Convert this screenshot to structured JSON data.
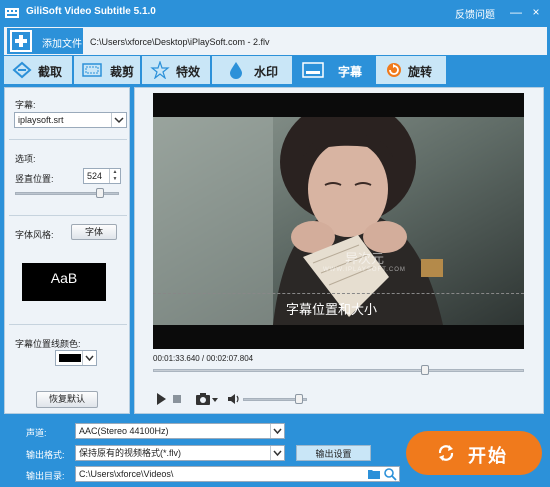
{
  "titlebar": {
    "title": "GiliSoft Video Subtitle 5.1.0",
    "feedback": "反馈问题",
    "minimize": "—",
    "close": "×"
  },
  "file": {
    "add_label": "添加文件",
    "path": "C:\\Users\\xforce\\Desktop\\iPlaySoft.com - 2.flv"
  },
  "tabs": [
    {
      "label": "截取",
      "icon": "crop-icon"
    },
    {
      "label": "裁剪",
      "icon": "trim-icon"
    },
    {
      "label": "特效",
      "icon": "effects-icon"
    },
    {
      "label": "水印",
      "icon": "watermark-icon"
    },
    {
      "label": "字幕",
      "icon": "subtitle-icon",
      "active": true
    },
    {
      "label": "旋转",
      "icon": "rotate-icon"
    }
  ],
  "left": {
    "subtitle_label": "字幕:",
    "subtitle_file": "iplaysoft.srt",
    "options_label": "选项:",
    "vpos_label": "竖直位置:",
    "vpos_value": "524",
    "vpos_slider": 0.82,
    "font_style_label": "字体风格:",
    "font_button": "字体",
    "font_preview": "AaB",
    "line_color_label": "字幕位置线颜色:",
    "line_color": "#000000",
    "reset_button": "恢复默认"
  },
  "preview": {
    "subtitle_text": "字幕位置和大小",
    "watermark_main": "异次元",
    "watermark_sub": "WWW.IPLAYSOFT.COM",
    "time": "00:01:33.640 / 00:02:07.804",
    "progress": 0.7327
  },
  "bottom": {
    "audio_label": "声道:",
    "audio_value": "AAC(Stereo 44100Hz)",
    "format_label": "输出格式:",
    "format_value": "保持原有的视频格式(*.flv)",
    "settings_button": "输出设置",
    "dir_label": "输出目录:",
    "dir_value": "C:\\Users\\xforce\\Videos\\",
    "start_button": "开始"
  },
  "colors": {
    "accent": "#2c91d9",
    "tab_bg": "#c9e6f7",
    "start": "#f07a1c"
  }
}
